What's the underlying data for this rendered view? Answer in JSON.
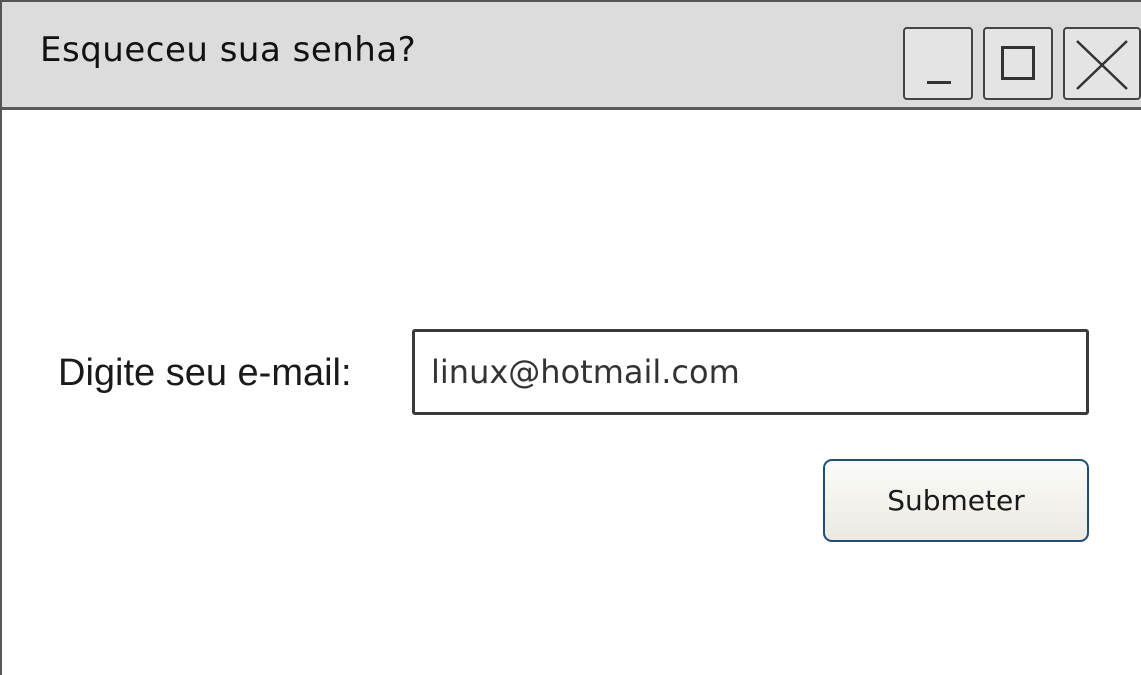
{
  "window": {
    "title": "Esqueceu sua senha?"
  },
  "form": {
    "email_label": "Digite seu e-mail:",
    "email_value": "linux@hotmail.com",
    "submit_label": "Submeter"
  },
  "icons": {
    "minimize": "minimize-icon",
    "maximize": "maximize-icon",
    "close": "close-icon"
  },
  "colors": {
    "titlebar": "#dcdcdc",
    "button_border": "#1f4e79"
  }
}
